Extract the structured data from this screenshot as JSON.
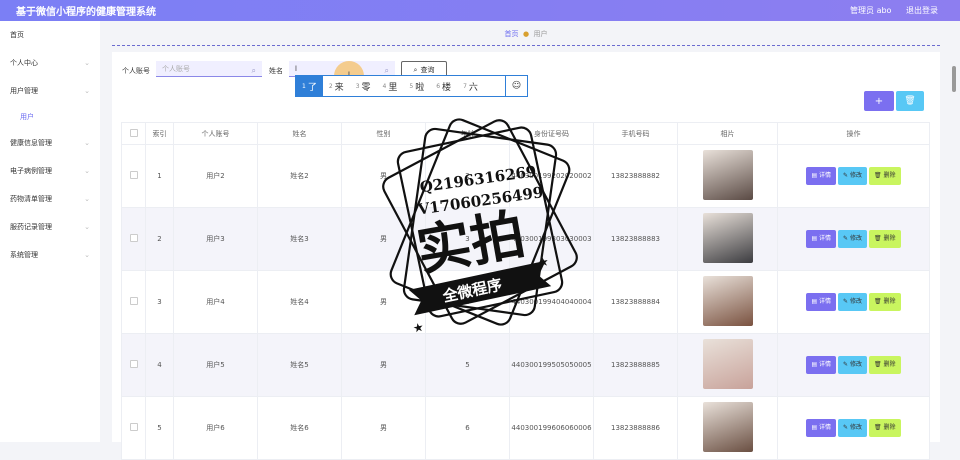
{
  "header": {
    "title": "基于微信小程序的健康管理系统",
    "admin": "管理员 abo",
    "logout": "退出登录"
  },
  "sidebar": {
    "items": [
      {
        "label": "首页",
        "chevron": false
      },
      {
        "label": "个人中心",
        "chevron": true
      },
      {
        "label": "用户管理",
        "chevron": true
      },
      {
        "label": "用户",
        "sub": true
      },
      {
        "label": "健康信息管理",
        "chevron": true
      },
      {
        "label": "电子病例管理",
        "chevron": true
      },
      {
        "label": "药物清单管理",
        "chevron": true
      },
      {
        "label": "服药记录管理",
        "chevron": true
      },
      {
        "label": "系统管理",
        "chevron": true
      }
    ]
  },
  "breadcrumb": {
    "home": "首页",
    "current": "用户"
  },
  "search": {
    "account_label": "个人账号",
    "account_placeholder": "个人账号",
    "name_label": "姓名",
    "name_value": "l",
    "query_label": "查询"
  },
  "ime": {
    "candidates": [
      {
        "n": "1",
        "w": "了"
      },
      {
        "n": "2",
        "w": "来"
      },
      {
        "n": "3",
        "w": "零"
      },
      {
        "n": "4",
        "w": "里"
      },
      {
        "n": "5",
        "w": "啦"
      },
      {
        "n": "6",
        "w": "楼"
      },
      {
        "n": "7",
        "w": "六"
      }
    ],
    "emoji": "☺"
  },
  "toolbar": {
    "add_icon": "+",
    "delete_icon": "🗑"
  },
  "table": {
    "headers": [
      "索引",
      "个人账号",
      "姓名",
      "性别",
      "年龄",
      "身份证号码",
      "手机号码",
      "相片",
      "操作"
    ],
    "rows": [
      {
        "idx": "1",
        "account": "用户2",
        "name": "姓名2",
        "gender": "男",
        "age": "2",
        "id": "440300199202020002",
        "phone": "13823888882",
        "photo": "#5a4a44"
      },
      {
        "idx": "2",
        "account": "用户3",
        "name": "姓名3",
        "gender": "男",
        "age": "3",
        "id": "440300199303030003",
        "phone": "13823888883",
        "photo": "#3c3c40"
      },
      {
        "idx": "3",
        "account": "用户4",
        "name": "姓名4",
        "gender": "男",
        "age": "4",
        "id": "440300199404040004",
        "phone": "13823888884",
        "photo": "#7a5240"
      },
      {
        "idx": "4",
        "account": "用户5",
        "name": "姓名5",
        "gender": "男",
        "age": "5",
        "id": "440300199505050005",
        "phone": "13823888885",
        "photo": "#c8a29a"
      },
      {
        "idx": "5",
        "account": "用户6",
        "name": "姓名6",
        "gender": "男",
        "age": "6",
        "id": "440300199606060006",
        "phone": "13823888886",
        "photo": "#6a4f42"
      }
    ],
    "actions": {
      "detail": "详情",
      "edit": "修改",
      "delete": "删除"
    }
  },
  "watermark": {
    "qq": "Q2196316269",
    "v": "V17060256499",
    "main": "实拍",
    "banner": "全微程序"
  }
}
